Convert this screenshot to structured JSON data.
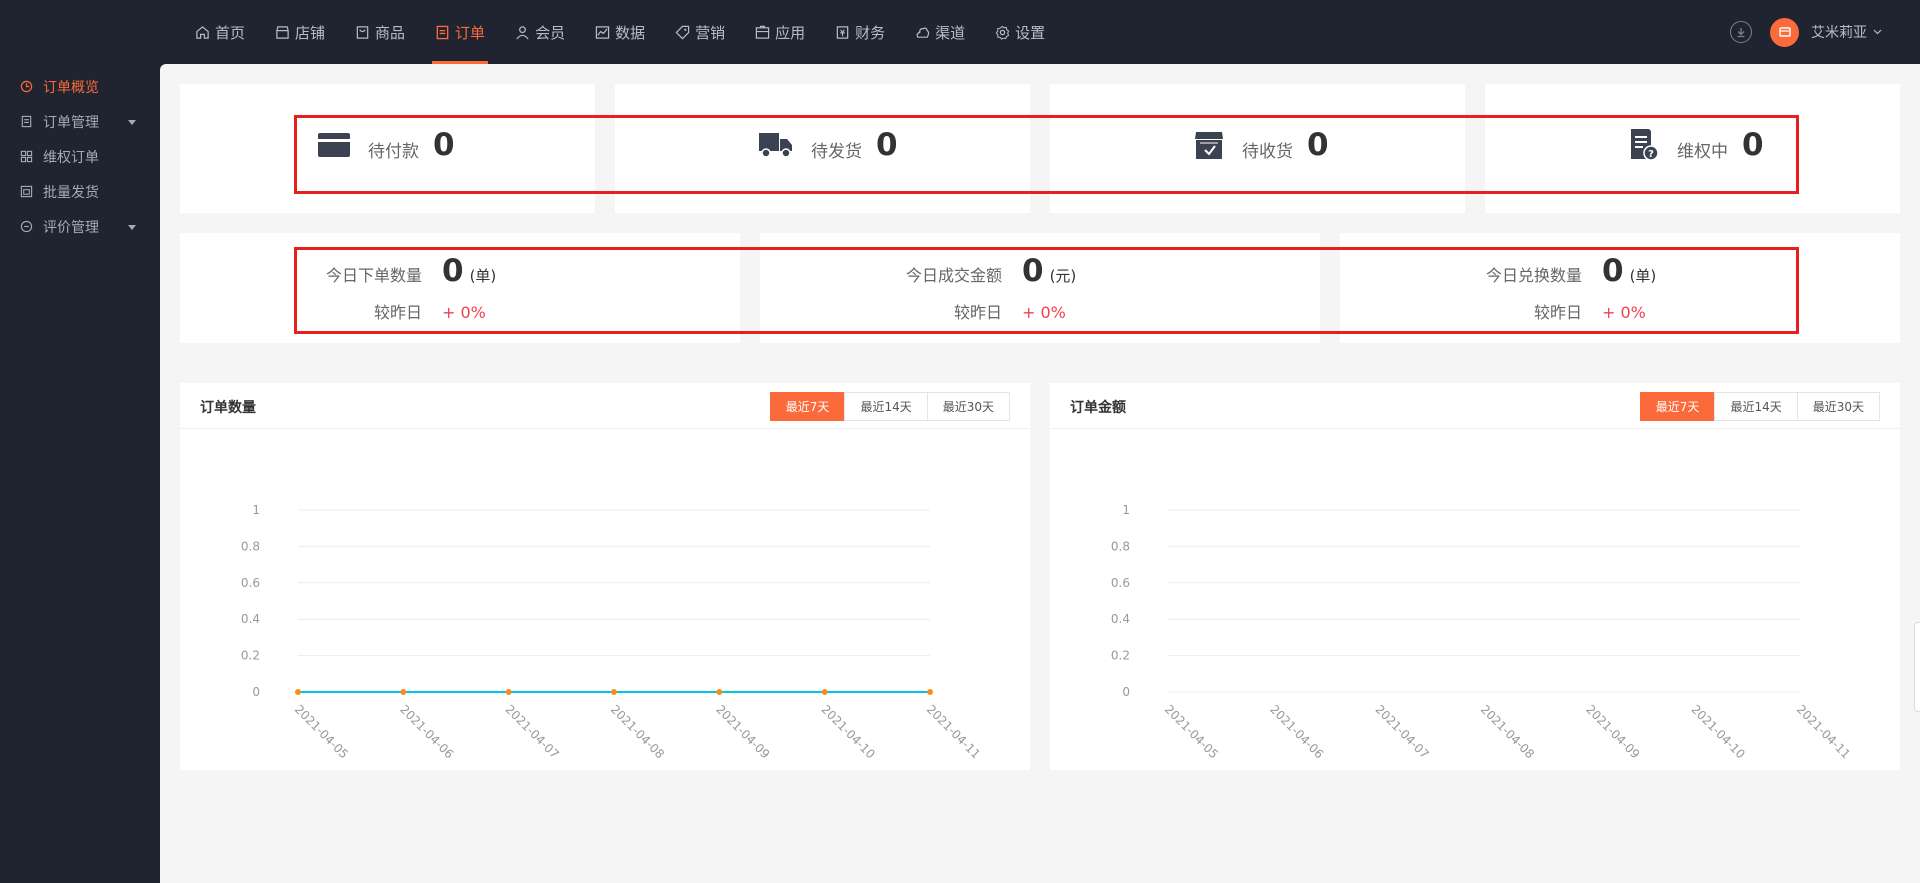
{
  "nav": {
    "items": [
      {
        "label": "首页",
        "icon": "home-icon",
        "active": false
      },
      {
        "label": "店铺",
        "icon": "store-icon",
        "active": false
      },
      {
        "label": "商品",
        "icon": "goods-icon",
        "active": false
      },
      {
        "label": "订单",
        "icon": "order-icon",
        "active": true
      },
      {
        "label": "会员",
        "icon": "member-icon",
        "active": false
      },
      {
        "label": "数据",
        "icon": "data-icon",
        "active": false
      },
      {
        "label": "营销",
        "icon": "tag-icon",
        "active": false
      },
      {
        "label": "应用",
        "icon": "app-icon",
        "active": false
      },
      {
        "label": "财务",
        "icon": "finance-icon",
        "active": false
      },
      {
        "label": "渠道",
        "icon": "channel-icon",
        "active": false
      },
      {
        "label": "设置",
        "icon": "gear-icon",
        "active": false
      }
    ],
    "username": "艾米莉亚",
    "accent": "#fb6a3b"
  },
  "sidebar": {
    "items": [
      {
        "label": "订单概览",
        "active": true,
        "expandable": false
      },
      {
        "label": "订单管理",
        "active": false,
        "expandable": true
      },
      {
        "label": "维权订单",
        "active": false,
        "expandable": false
      },
      {
        "label": "批量发货",
        "active": false,
        "expandable": false
      },
      {
        "label": "评价管理",
        "active": false,
        "expandable": true
      }
    ]
  },
  "status_cards": [
    {
      "label": "待付款",
      "value": "0",
      "icon": "wallet-icon"
    },
    {
      "label": "待发货",
      "value": "0",
      "icon": "truck-icon"
    },
    {
      "label": "待收货",
      "value": "0",
      "icon": "box-check-icon"
    },
    {
      "label": "维权中",
      "value": "0",
      "icon": "document-question-icon"
    }
  ],
  "today_cards": [
    {
      "label": "今日下单数量",
      "value": "0",
      "unit": "(单)",
      "compare_label": "较昨日",
      "compare_value": "+ 0%"
    },
    {
      "label": "今日成交金额",
      "value": "0",
      "unit": "(元)",
      "compare_label": "较昨日",
      "compare_value": "+ 0%"
    },
    {
      "label": "今日兑换数量",
      "value": "0",
      "unit": "(单)",
      "compare_label": "较昨日",
      "compare_value": "+ 0%"
    }
  ],
  "charts": {
    "order_count": {
      "title": "订单数量",
      "ranges": [
        "最近7天",
        "最近14天",
        "最近30天"
      ],
      "active_range": 0
    },
    "order_amount": {
      "title": "订单金额",
      "ranges": [
        "最近7天",
        "最近14天",
        "最近30天"
      ],
      "active_range": 0
    }
  },
  "chart_data": [
    {
      "type": "line",
      "title": "订单数量",
      "x": [
        "2021-04-05",
        "2021-04-06",
        "2021-04-07",
        "2021-04-08",
        "2021-04-09",
        "2021-04-10",
        "2021-04-11"
      ],
      "series": [
        {
          "values": [
            0,
            0,
            0,
            0,
            0,
            0,
            0
          ],
          "color": "#00c6e6",
          "marker_color": "#fb8c1a"
        }
      ],
      "yticks": [
        "0",
        "0.2",
        "0.4",
        "0.6",
        "0.8",
        "1"
      ],
      "ylim": [
        0,
        1
      ],
      "grid": true,
      "show_series": true
    },
    {
      "type": "line",
      "title": "订单金额",
      "x": [
        "2021-04-05",
        "2021-04-06",
        "2021-04-07",
        "2021-04-08",
        "2021-04-09",
        "2021-04-10",
        "2021-04-11"
      ],
      "series": [],
      "yticks": [
        "0",
        "0.2",
        "0.4",
        "0.6",
        "0.8",
        "1"
      ],
      "ylim": [
        0,
        1
      ],
      "grid": true,
      "show_series": false
    }
  ]
}
